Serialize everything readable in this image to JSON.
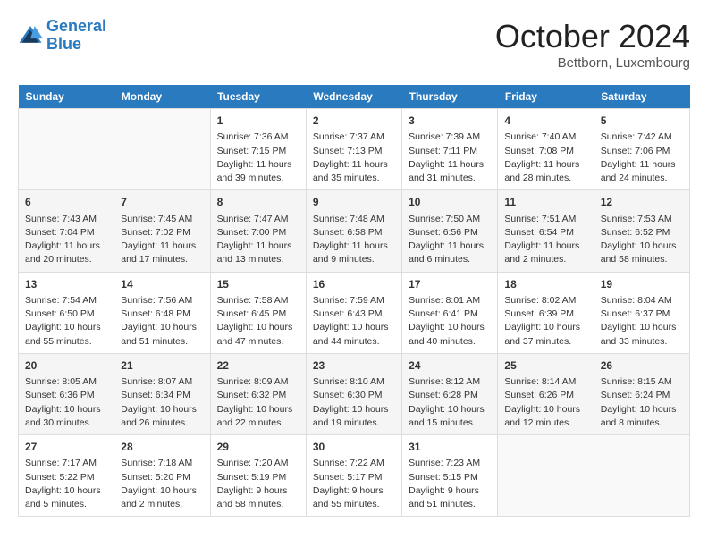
{
  "header": {
    "logo_line1": "General",
    "logo_line2": "Blue",
    "month": "October 2024",
    "location": "Bettborn, Luxembourg"
  },
  "weekdays": [
    "Sunday",
    "Monday",
    "Tuesday",
    "Wednesday",
    "Thursday",
    "Friday",
    "Saturday"
  ],
  "weeks": [
    [
      {
        "day": "",
        "detail": ""
      },
      {
        "day": "",
        "detail": ""
      },
      {
        "day": "1",
        "detail": "Sunrise: 7:36 AM\nSunset: 7:15 PM\nDaylight: 11 hours and 39 minutes."
      },
      {
        "day": "2",
        "detail": "Sunrise: 7:37 AM\nSunset: 7:13 PM\nDaylight: 11 hours and 35 minutes."
      },
      {
        "day": "3",
        "detail": "Sunrise: 7:39 AM\nSunset: 7:11 PM\nDaylight: 11 hours and 31 minutes."
      },
      {
        "day": "4",
        "detail": "Sunrise: 7:40 AM\nSunset: 7:08 PM\nDaylight: 11 hours and 28 minutes."
      },
      {
        "day": "5",
        "detail": "Sunrise: 7:42 AM\nSunset: 7:06 PM\nDaylight: 11 hours and 24 minutes."
      }
    ],
    [
      {
        "day": "6",
        "detail": "Sunrise: 7:43 AM\nSunset: 7:04 PM\nDaylight: 11 hours and 20 minutes."
      },
      {
        "day": "7",
        "detail": "Sunrise: 7:45 AM\nSunset: 7:02 PM\nDaylight: 11 hours and 17 minutes."
      },
      {
        "day": "8",
        "detail": "Sunrise: 7:47 AM\nSunset: 7:00 PM\nDaylight: 11 hours and 13 minutes."
      },
      {
        "day": "9",
        "detail": "Sunrise: 7:48 AM\nSunset: 6:58 PM\nDaylight: 11 hours and 9 minutes."
      },
      {
        "day": "10",
        "detail": "Sunrise: 7:50 AM\nSunset: 6:56 PM\nDaylight: 11 hours and 6 minutes."
      },
      {
        "day": "11",
        "detail": "Sunrise: 7:51 AM\nSunset: 6:54 PM\nDaylight: 11 hours and 2 minutes."
      },
      {
        "day": "12",
        "detail": "Sunrise: 7:53 AM\nSunset: 6:52 PM\nDaylight: 10 hours and 58 minutes."
      }
    ],
    [
      {
        "day": "13",
        "detail": "Sunrise: 7:54 AM\nSunset: 6:50 PM\nDaylight: 10 hours and 55 minutes."
      },
      {
        "day": "14",
        "detail": "Sunrise: 7:56 AM\nSunset: 6:48 PM\nDaylight: 10 hours and 51 minutes."
      },
      {
        "day": "15",
        "detail": "Sunrise: 7:58 AM\nSunset: 6:45 PM\nDaylight: 10 hours and 47 minutes."
      },
      {
        "day": "16",
        "detail": "Sunrise: 7:59 AM\nSunset: 6:43 PM\nDaylight: 10 hours and 44 minutes."
      },
      {
        "day": "17",
        "detail": "Sunrise: 8:01 AM\nSunset: 6:41 PM\nDaylight: 10 hours and 40 minutes."
      },
      {
        "day": "18",
        "detail": "Sunrise: 8:02 AM\nSunset: 6:39 PM\nDaylight: 10 hours and 37 minutes."
      },
      {
        "day": "19",
        "detail": "Sunrise: 8:04 AM\nSunset: 6:37 PM\nDaylight: 10 hours and 33 minutes."
      }
    ],
    [
      {
        "day": "20",
        "detail": "Sunrise: 8:05 AM\nSunset: 6:36 PM\nDaylight: 10 hours and 30 minutes."
      },
      {
        "day": "21",
        "detail": "Sunrise: 8:07 AM\nSunset: 6:34 PM\nDaylight: 10 hours and 26 minutes."
      },
      {
        "day": "22",
        "detail": "Sunrise: 8:09 AM\nSunset: 6:32 PM\nDaylight: 10 hours and 22 minutes."
      },
      {
        "day": "23",
        "detail": "Sunrise: 8:10 AM\nSunset: 6:30 PM\nDaylight: 10 hours and 19 minutes."
      },
      {
        "day": "24",
        "detail": "Sunrise: 8:12 AM\nSunset: 6:28 PM\nDaylight: 10 hours and 15 minutes."
      },
      {
        "day": "25",
        "detail": "Sunrise: 8:14 AM\nSunset: 6:26 PM\nDaylight: 10 hours and 12 minutes."
      },
      {
        "day": "26",
        "detail": "Sunrise: 8:15 AM\nSunset: 6:24 PM\nDaylight: 10 hours and 8 minutes."
      }
    ],
    [
      {
        "day": "27",
        "detail": "Sunrise: 7:17 AM\nSunset: 5:22 PM\nDaylight: 10 hours and 5 minutes."
      },
      {
        "day": "28",
        "detail": "Sunrise: 7:18 AM\nSunset: 5:20 PM\nDaylight: 10 hours and 2 minutes."
      },
      {
        "day": "29",
        "detail": "Sunrise: 7:20 AM\nSunset: 5:19 PM\nDaylight: 9 hours and 58 minutes."
      },
      {
        "day": "30",
        "detail": "Sunrise: 7:22 AM\nSunset: 5:17 PM\nDaylight: 9 hours and 55 minutes."
      },
      {
        "day": "31",
        "detail": "Sunrise: 7:23 AM\nSunset: 5:15 PM\nDaylight: 9 hours and 51 minutes."
      },
      {
        "day": "",
        "detail": ""
      },
      {
        "day": "",
        "detail": ""
      }
    ]
  ]
}
